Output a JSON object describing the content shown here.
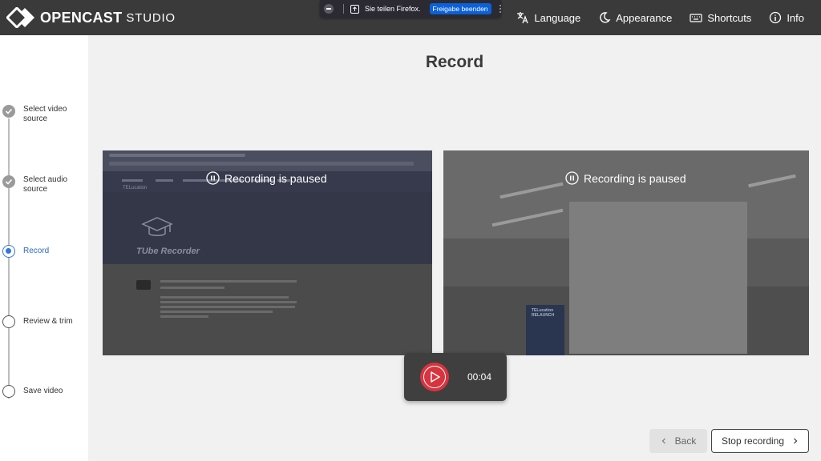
{
  "app": {
    "logo_text": "OPENCAST",
    "logo_sub": "STUDIO"
  },
  "nav": {
    "language": "Language",
    "appearance": "Appearance",
    "shortcuts": "Shortcuts",
    "info": "Info"
  },
  "sharebar": {
    "text": "Sie teilen Firefox.",
    "button": "Freigabe beenden"
  },
  "steps": [
    {
      "label": "Select video source",
      "state": "done"
    },
    {
      "label": "Select audio source",
      "state": "done"
    },
    {
      "label": "Record",
      "state": "active"
    },
    {
      "label": "Review & trim",
      "state": "todo"
    },
    {
      "label": "Save video",
      "state": "todo"
    }
  ],
  "main": {
    "title": "Record"
  },
  "previews": {
    "left_status": "Recording is paused",
    "right_status": "Recording is paused",
    "left_site_label": "TUbe Recorder",
    "left_site_brand": "TELucation",
    "right_poster_text": "TELucation RELAUNCH"
  },
  "recorder": {
    "time": "00:04",
    "state": "paused"
  },
  "footer": {
    "back": "Back",
    "stop": "Stop recording"
  },
  "colors": {
    "header_bg": "#3a3a3a",
    "record_red": "#d7343f",
    "active_step": "#3476e0",
    "share_button": "#0a61d9"
  }
}
